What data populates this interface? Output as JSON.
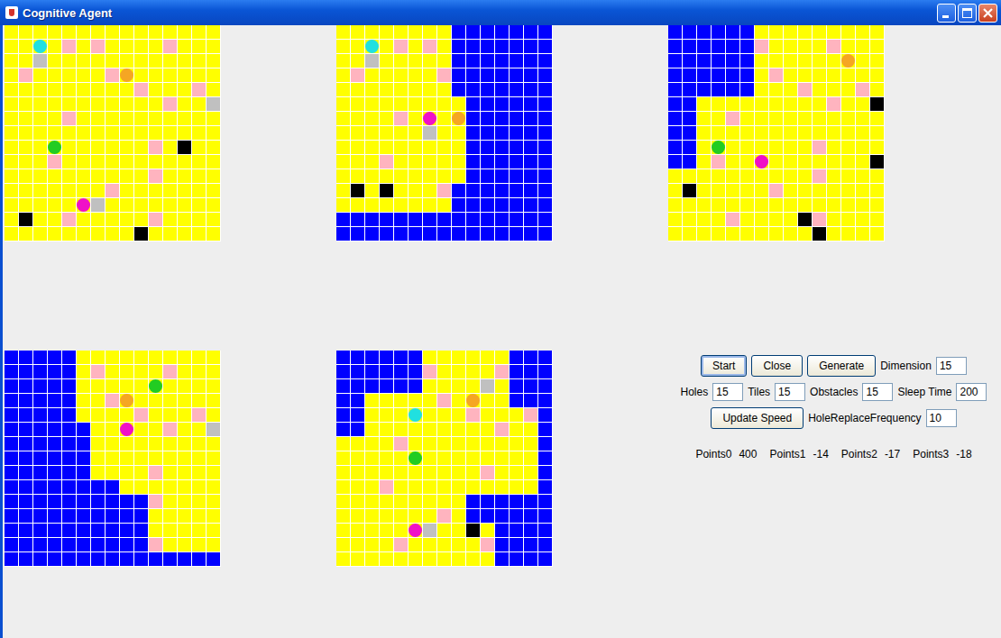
{
  "window": {
    "title": "Cognitive Agent"
  },
  "maps": [
    {
      "cells": [
        "YYYYYYYYYYYYYYY",
        "YYYYPYPYYYYPYYY",
        "YYGYYYYYYYYYYYY",
        "YPYYYYYPYYYYYYY",
        "YYYYYYYYYPYYYPY",
        "YYYYYYYYYYYPYYG",
        "YYYYPYYYYYYYYYY",
        "YYYYYYYYYYYYYYY",
        "YYYYYYYYYYPYKYY",
        "YYYPYYYYYYYYYYY",
        "YYYYYYYYYYPYYYY",
        "YYYYYYYPYYYYYYY",
        "YYYYYYGYYYYYYYY",
        "YKYYPYYYYYPYYYY",
        "YYYYYYYYYKYYYYY"
      ],
      "agents": [
        {
          "row": 1,
          "col": 2,
          "color": "#20e0e0"
        },
        {
          "row": 3,
          "col": 8,
          "color": "#f5a623"
        },
        {
          "row": 8,
          "col": 3,
          "color": "#22cc22"
        },
        {
          "row": 12,
          "col": 5,
          "color": "#f010c8"
        }
      ]
    },
    {
      "cells": [
        "YYYYYYYYBBBBBBB",
        "YYYYPYPYBBBBBBB",
        "YYGYYYYYBBBBBBB",
        "YPYYYYYPBBBBBBB",
        "YYYYYYYYBBBBBBB",
        "YYYYYYYYYBBBBBB",
        "YYYYPYYYYBBBBBB",
        "YYYYYYGYYBBBBBB",
        "YYYYYYYYYBBBBBB",
        "YYYPYYYYYBBBBBB",
        "YYYYYYYYYBBBBBB",
        "YKYKYYYPBBBBBBB",
        "YYYYYYYYBBBBBBB",
        "BBBBBBBBBBBBBBB",
        "BBBBBBBBBBBBBBB"
      ],
      "agents": [
        {
          "row": 1,
          "col": 2,
          "color": "#20e0e0"
        },
        {
          "row": 6,
          "col": 6,
          "color": "#f010c8"
        },
        {
          "row": 6,
          "col": 8,
          "color": "#f5a623"
        }
      ]
    },
    {
      "cells": [
        "BBBBBBYYYYYYYYY",
        "BBBBBBPYYYYPYYY",
        "BBBBBBYYYYYYYYY",
        "BBBBBBYPYYYYYYY",
        "BBBBBBYYYPYYYPY",
        "BBYYYYYYYYYPYYK",
        "BBYYPYYYYYYYYYY",
        "BBYYYYYYYYYYYYY",
        "BBYYYYYYYYPYYYY",
        "BBYPYYYYYYYYYYK",
        "YYYYYYYYYYPYYYY",
        "YKYYYYYPYYYYYYY",
        "YYYYYYYYYYYYYYY",
        "YYYYPYYYYKPYYYY",
        "YYYYYYYYYYKYYYY"
      ],
      "agents": [
        {
          "row": 2,
          "col": 12,
          "color": "#f5a623"
        },
        {
          "row": 8,
          "col": 3,
          "color": "#22cc22"
        },
        {
          "row": 9,
          "col": 6,
          "color": "#f010c8"
        }
      ]
    },
    {
      "cells": [
        "BBBBBYYYYYYYYYY",
        "BBBBBYPYYYYPYYY",
        "BBBBBYYYYYYYYYY",
        "BBBBBYYPYYYYYYY",
        "BBBBBYYYYPYYYPY",
        "BBBBBBYYYYYPYYG",
        "BBBBBBYYYYYYYYY",
        "BBBBBBYYYYYYYYY",
        "BBBBBBYYYYPYYYY",
        "BBBBBBBBYYYYYYY",
        "BBBBBBBBBBPYYYY",
        "BBBBBBBBBBYYYYY",
        "BBBBBBBBBBYYYYY",
        "BBBBBBBBBBPYYYY",
        "BBBBBBBBBBBBBBB"
      ],
      "agents": [
        {
          "row": 2,
          "col": 10,
          "color": "#22cc22"
        },
        {
          "row": 3,
          "col": 8,
          "color": "#f5a623"
        },
        {
          "row": 5,
          "col": 8,
          "color": "#f010c8"
        }
      ]
    },
    {
      "cells": [
        "BBBBBBYYYYYYBBB",
        "BBBBBBPYYYYPBBB",
        "BBBBBBYYYYGYBBB",
        "BBYYYYYPYYYYBBB",
        "BBYYYYYYYPYYYPB",
        "BBYYYYYYYYYPYYB",
        "YYYYPYYYYYYYYYB",
        "YYYYYYYYYYYYYYB",
        "YYYYYYYYYYPYYYB",
        "YYYPYYYYYYYYYYB",
        "YYYYYYYYYBBBBBB",
        "YYYYYYYPYBBBBBB",
        "YYYYYYGYYKYBBBB",
        "YYYYPYYYYYPBBBB",
        "YYYYYYYYYYYBBBB"
      ],
      "agents": [
        {
          "row": 3,
          "col": 9,
          "color": "#f5a623"
        },
        {
          "row": 4,
          "col": 5,
          "color": "#20e0e0"
        },
        {
          "row": 7,
          "col": 5,
          "color": "#22cc22"
        },
        {
          "row": 12,
          "col": 5,
          "color": "#f010c8"
        }
      ]
    }
  ],
  "controls": [
    [
      {
        "kind": "button",
        "text": "Start",
        "focused": true
      },
      {
        "kind": "button",
        "text": "Close",
        "focused": false
      },
      {
        "kind": "button",
        "text": "Generate",
        "focused": false
      },
      {
        "kind": "label",
        "text": "Dimension"
      },
      {
        "kind": "field",
        "text": "15"
      }
    ],
    [
      {
        "kind": "label",
        "text": "Holes"
      },
      {
        "kind": "field",
        "text": "15"
      },
      {
        "kind": "label",
        "text": "Tiles"
      },
      {
        "kind": "field",
        "text": "15"
      },
      {
        "kind": "label",
        "text": "Obstacles"
      },
      {
        "kind": "field",
        "text": "15"
      },
      {
        "kind": "label",
        "text": "Sleep Time"
      },
      {
        "kind": "field",
        "text": "200"
      }
    ],
    [
      {
        "kind": "button",
        "text": "Update Speed",
        "focused": false
      },
      {
        "kind": "label",
        "text": "HoleReplaceFrequency"
      },
      {
        "kind": "field",
        "text": "10"
      }
    ]
  ],
  "points": [
    {
      "label": "Points0",
      "value": "400"
    },
    {
      "label": "Points1",
      "value": "-14"
    },
    {
      "label": "Points2",
      "value": "-17"
    },
    {
      "label": "Points3",
      "value": "-18"
    }
  ]
}
